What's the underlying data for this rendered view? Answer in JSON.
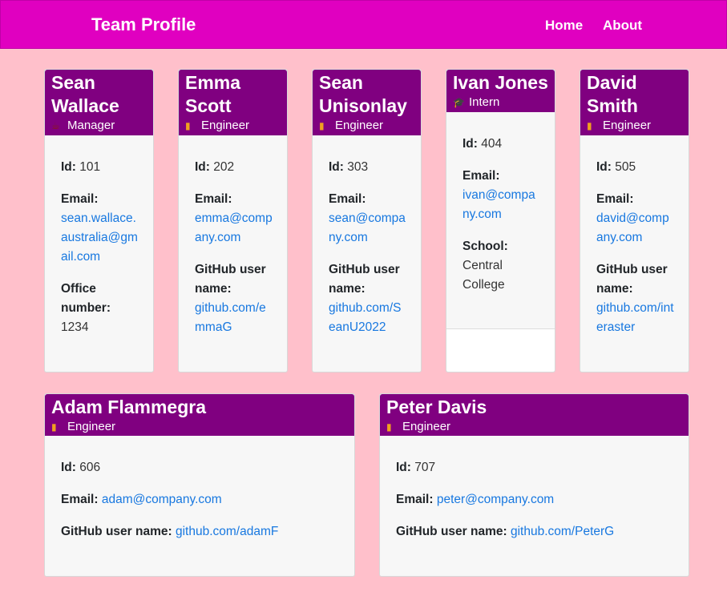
{
  "app": {
    "title": "Team Profile",
    "nav": [
      {
        "label": "Home"
      },
      {
        "label": "About"
      }
    ]
  },
  "labels": {
    "id": "Id:",
    "email": "Email:",
    "office": "Office number:",
    "github": "GitHub user name:",
    "school": "School:"
  },
  "members": [
    {
      "name": "Sean Wallace",
      "role": "Manager",
      "icon": "coffee-mug-icon",
      "id": "101",
      "email": "sean.wallace.australia@gmail.com",
      "office": "1234"
    },
    {
      "name": "Emma Scott",
      "role": "Engineer",
      "icon": "book-icon",
      "id": "202",
      "email": "emma@company.com",
      "github": "github.com/emmaG"
    },
    {
      "name": "Sean Unisonlay",
      "role": "Engineer",
      "icon": "book-icon",
      "id": "303",
      "email": "sean@company.com",
      "github": "github.com/SeanU2022"
    },
    {
      "name": "Ivan Jones",
      "role": "Intern",
      "icon": "graduation-cap-icon",
      "id": "404",
      "email": "ivan@company.com",
      "school": "Central College"
    },
    {
      "name": "David Smith",
      "role": "Engineer",
      "icon": "book-icon",
      "id": "505",
      "email": "david@company.com",
      "github": "github.com/interaster"
    },
    {
      "name": "Adam Flammegra",
      "role": "Engineer",
      "icon": "book-icon",
      "id": "606",
      "email": "adam@company.com",
      "github": "github.com/adamF"
    },
    {
      "name": "Peter Davis",
      "role": "Engineer",
      "icon": "book-icon",
      "id": "707",
      "email": "peter@company.com",
      "github": "github.com/PeterG"
    }
  ],
  "colors": {
    "navbar": "#e000c0",
    "card_header": "#800080",
    "background": "#ffc0cb",
    "link": "#1878e0"
  }
}
